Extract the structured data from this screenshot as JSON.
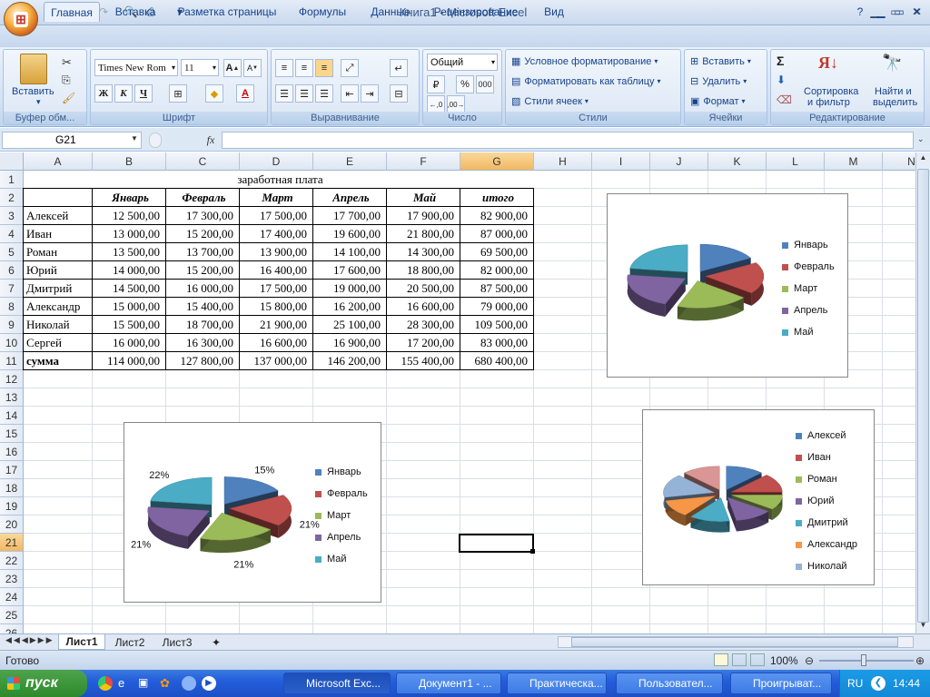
{
  "window": {
    "title": "Книга1 - Microsoft Excel"
  },
  "ribbon": {
    "tabs": [
      "Главная",
      "Вставка",
      "Разметка страницы",
      "Формулы",
      "Данные",
      "Рецензирование",
      "Вид"
    ],
    "clipboard": {
      "paste": "Вставить",
      "label": "Буфер обм..."
    },
    "font": {
      "name": "Times New Rom",
      "size": "11",
      "bold": "Ж",
      "italic": "К",
      "underline": "Ч",
      "label": "Шрифт"
    },
    "alignment": {
      "label": "Выравнивание"
    },
    "number": {
      "format": "Общий",
      "label": "Число",
      "percent": "%",
      "thousands": "000"
    },
    "styles": {
      "conditional": "Условное форматирование",
      "as_table": "Форматировать как таблицу",
      "cell_styles": "Стили ячеек",
      "label": "Стили"
    },
    "cells": {
      "insert": "Вставить",
      "delete": "Удалить",
      "format": "Формат",
      "label": "Ячейки"
    },
    "editing": {
      "sort": "Сортировка",
      "sort2": "и фильтр",
      "find": "Найти и",
      "find2": "выделить",
      "label": "Редактирование"
    }
  },
  "formula_bar": {
    "name_box": "G21",
    "fx": "fx",
    "value": ""
  },
  "columns": [
    "A",
    "B",
    "C",
    "D",
    "E",
    "F",
    "G",
    "H",
    "I",
    "J",
    "K",
    "L",
    "M",
    "N"
  ],
  "rows": [
    "1",
    "2",
    "3",
    "4",
    "5",
    "6",
    "7",
    "8",
    "9",
    "10",
    "11",
    "12",
    "13",
    "14",
    "15",
    "16",
    "17",
    "18",
    "19",
    "20",
    "21",
    "22",
    "23",
    "24",
    "25",
    "26"
  ],
  "sheet": {
    "title": "заработная плата",
    "headers": [
      "Январь",
      "Февраль",
      "Март",
      "Апрель",
      "Май",
      "итого"
    ],
    "data": [
      [
        "Алексей",
        "12 500,00",
        "17 300,00",
        "17 500,00",
        "17 700,00",
        "17 900,00",
        "82 900,00"
      ],
      [
        "Иван",
        "13 000,00",
        "15 200,00",
        "17 400,00",
        "19 600,00",
        "21 800,00",
        "87 000,00"
      ],
      [
        "Роман",
        "13 500,00",
        "13 700,00",
        "13 900,00",
        "14 100,00",
        "14 300,00",
        "69 500,00"
      ],
      [
        "Юрий",
        "14 000,00",
        "15 200,00",
        "16 400,00",
        "17 600,00",
        "18 800,00",
        "82 000,00"
      ],
      [
        "Дмитрий",
        "14 500,00",
        "16 000,00",
        "17 500,00",
        "19 000,00",
        "20 500,00",
        "87 500,00"
      ],
      [
        "Александр",
        "15 000,00",
        "15 400,00",
        "15 800,00",
        "16 200,00",
        "16 600,00",
        "79 000,00"
      ],
      [
        "Николай",
        "15 500,00",
        "18 700,00",
        "21 900,00",
        "25 100,00",
        "28 300,00",
        "109 500,00"
      ],
      [
        "Сергей",
        "16 000,00",
        "16 300,00",
        "16 600,00",
        "16 900,00",
        "17 200,00",
        "83 000,00"
      ]
    ],
    "total": [
      "сумма",
      "114 000,00",
      "127 800,00",
      "137 000,00",
      "146 200,00",
      "155 400,00",
      "680 400,00"
    ]
  },
  "chart_data": [
    {
      "type": "pie",
      "title": "",
      "categories": [
        "Январь",
        "Февраль",
        "Март",
        "Апрель",
        "Май"
      ],
      "values": [
        114000,
        127800,
        137000,
        146200,
        155400
      ],
      "legend": "right",
      "colors": [
        "#4f81bd",
        "#c0504d",
        "#9bbb59",
        "#8064a2",
        "#4bacc6"
      ]
    },
    {
      "type": "pie",
      "title": "",
      "categories": [
        "Январь",
        "Февраль",
        "Март",
        "Апрель",
        "Май"
      ],
      "values": [
        114000,
        127800,
        137000,
        146200,
        155400
      ],
      "data_labels": [
        "15%",
        "21%",
        "21%",
        "21%",
        "22%"
      ],
      "legend": "right",
      "colors": [
        "#4f81bd",
        "#c0504d",
        "#9bbb59",
        "#8064a2",
        "#4bacc6"
      ]
    },
    {
      "type": "pie",
      "title": "",
      "categories": [
        "Алексей",
        "Иван",
        "Роман",
        "Юрий",
        "Дмитрий",
        "Александр",
        "Николай"
      ],
      "values": [
        82900,
        87000,
        69500,
        82000,
        87500,
        79000,
        109500,
        83000
      ],
      "legend": "right",
      "colors": [
        "#4f81bd",
        "#c0504d",
        "#9bbb59",
        "#8064a2",
        "#4bacc6",
        "#f79646",
        "#95b3d7",
        "#d99694"
      ]
    }
  ],
  "sheet_tabs": [
    "Лист1",
    "Лист2",
    "Лист3"
  ],
  "status": {
    "text": "Готово",
    "zoom": "100%"
  },
  "taskbar": {
    "start": "пуск",
    "tasks": [
      "Microsoft Exc...",
      "Документ1 - ...",
      "Практическа...",
      "Пользовател...",
      "Проигрыват..."
    ],
    "lang": "RU",
    "time": "14:44"
  }
}
